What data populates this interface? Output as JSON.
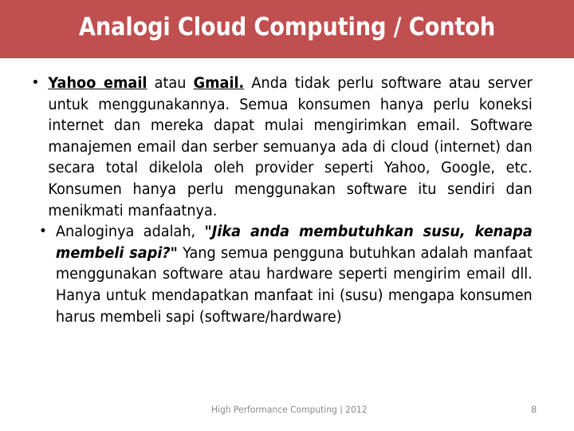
{
  "slide": {
    "title": "Analogi Cloud Computing / Contoh",
    "banner_color": "#c04f4f",
    "title_color": "#ffffff",
    "background_color": "#ffffff",
    "body_text_color": "#000000"
  },
  "bullets": [
    {
      "marker": "•",
      "segments": [
        {
          "text": "Yahoo email",
          "style": "bold-underline"
        },
        {
          "text": " atau ",
          "style": "normal"
        },
        {
          "text": "Gmail.",
          "style": "bold-underline"
        },
        {
          "text": " Anda tidak perlu software atau server untuk menggunakannya. Semua konsumen hanya perlu koneksi internet dan mereka dapat mulai mengirimkan email. Software manajemen email dan serber semuanya ada di cloud (internet) dan secara total dikelola oleh provider seperti Yahoo, Google, etc. Konsumen hanya perlu menggunakan software itu sendiri dan menikmati manfaatnya.",
          "style": "normal"
        }
      ]
    },
    {
      "marker": "•",
      "segments": [
        {
          "text": "Analoginya adalah, ",
          "style": "normal"
        },
        {
          "text": "\"Jika anda membutuhkan susu, kenapa membeli sapi?\"",
          "style": "bold-italic"
        },
        {
          "text": " Yang semua pengguna butuhkan adalah manfaat menggunakan software atau hardware seperti mengirim email dll. Hanya untuk mendapatkan manfaat ini (susu) mengapa konsumen harus membeli sapi (software/hardware)",
          "style": "normal"
        }
      ]
    }
  ],
  "footer": {
    "text": "High Performance Computing | 2012",
    "page_number": "8",
    "color": "#8a8a8a"
  }
}
